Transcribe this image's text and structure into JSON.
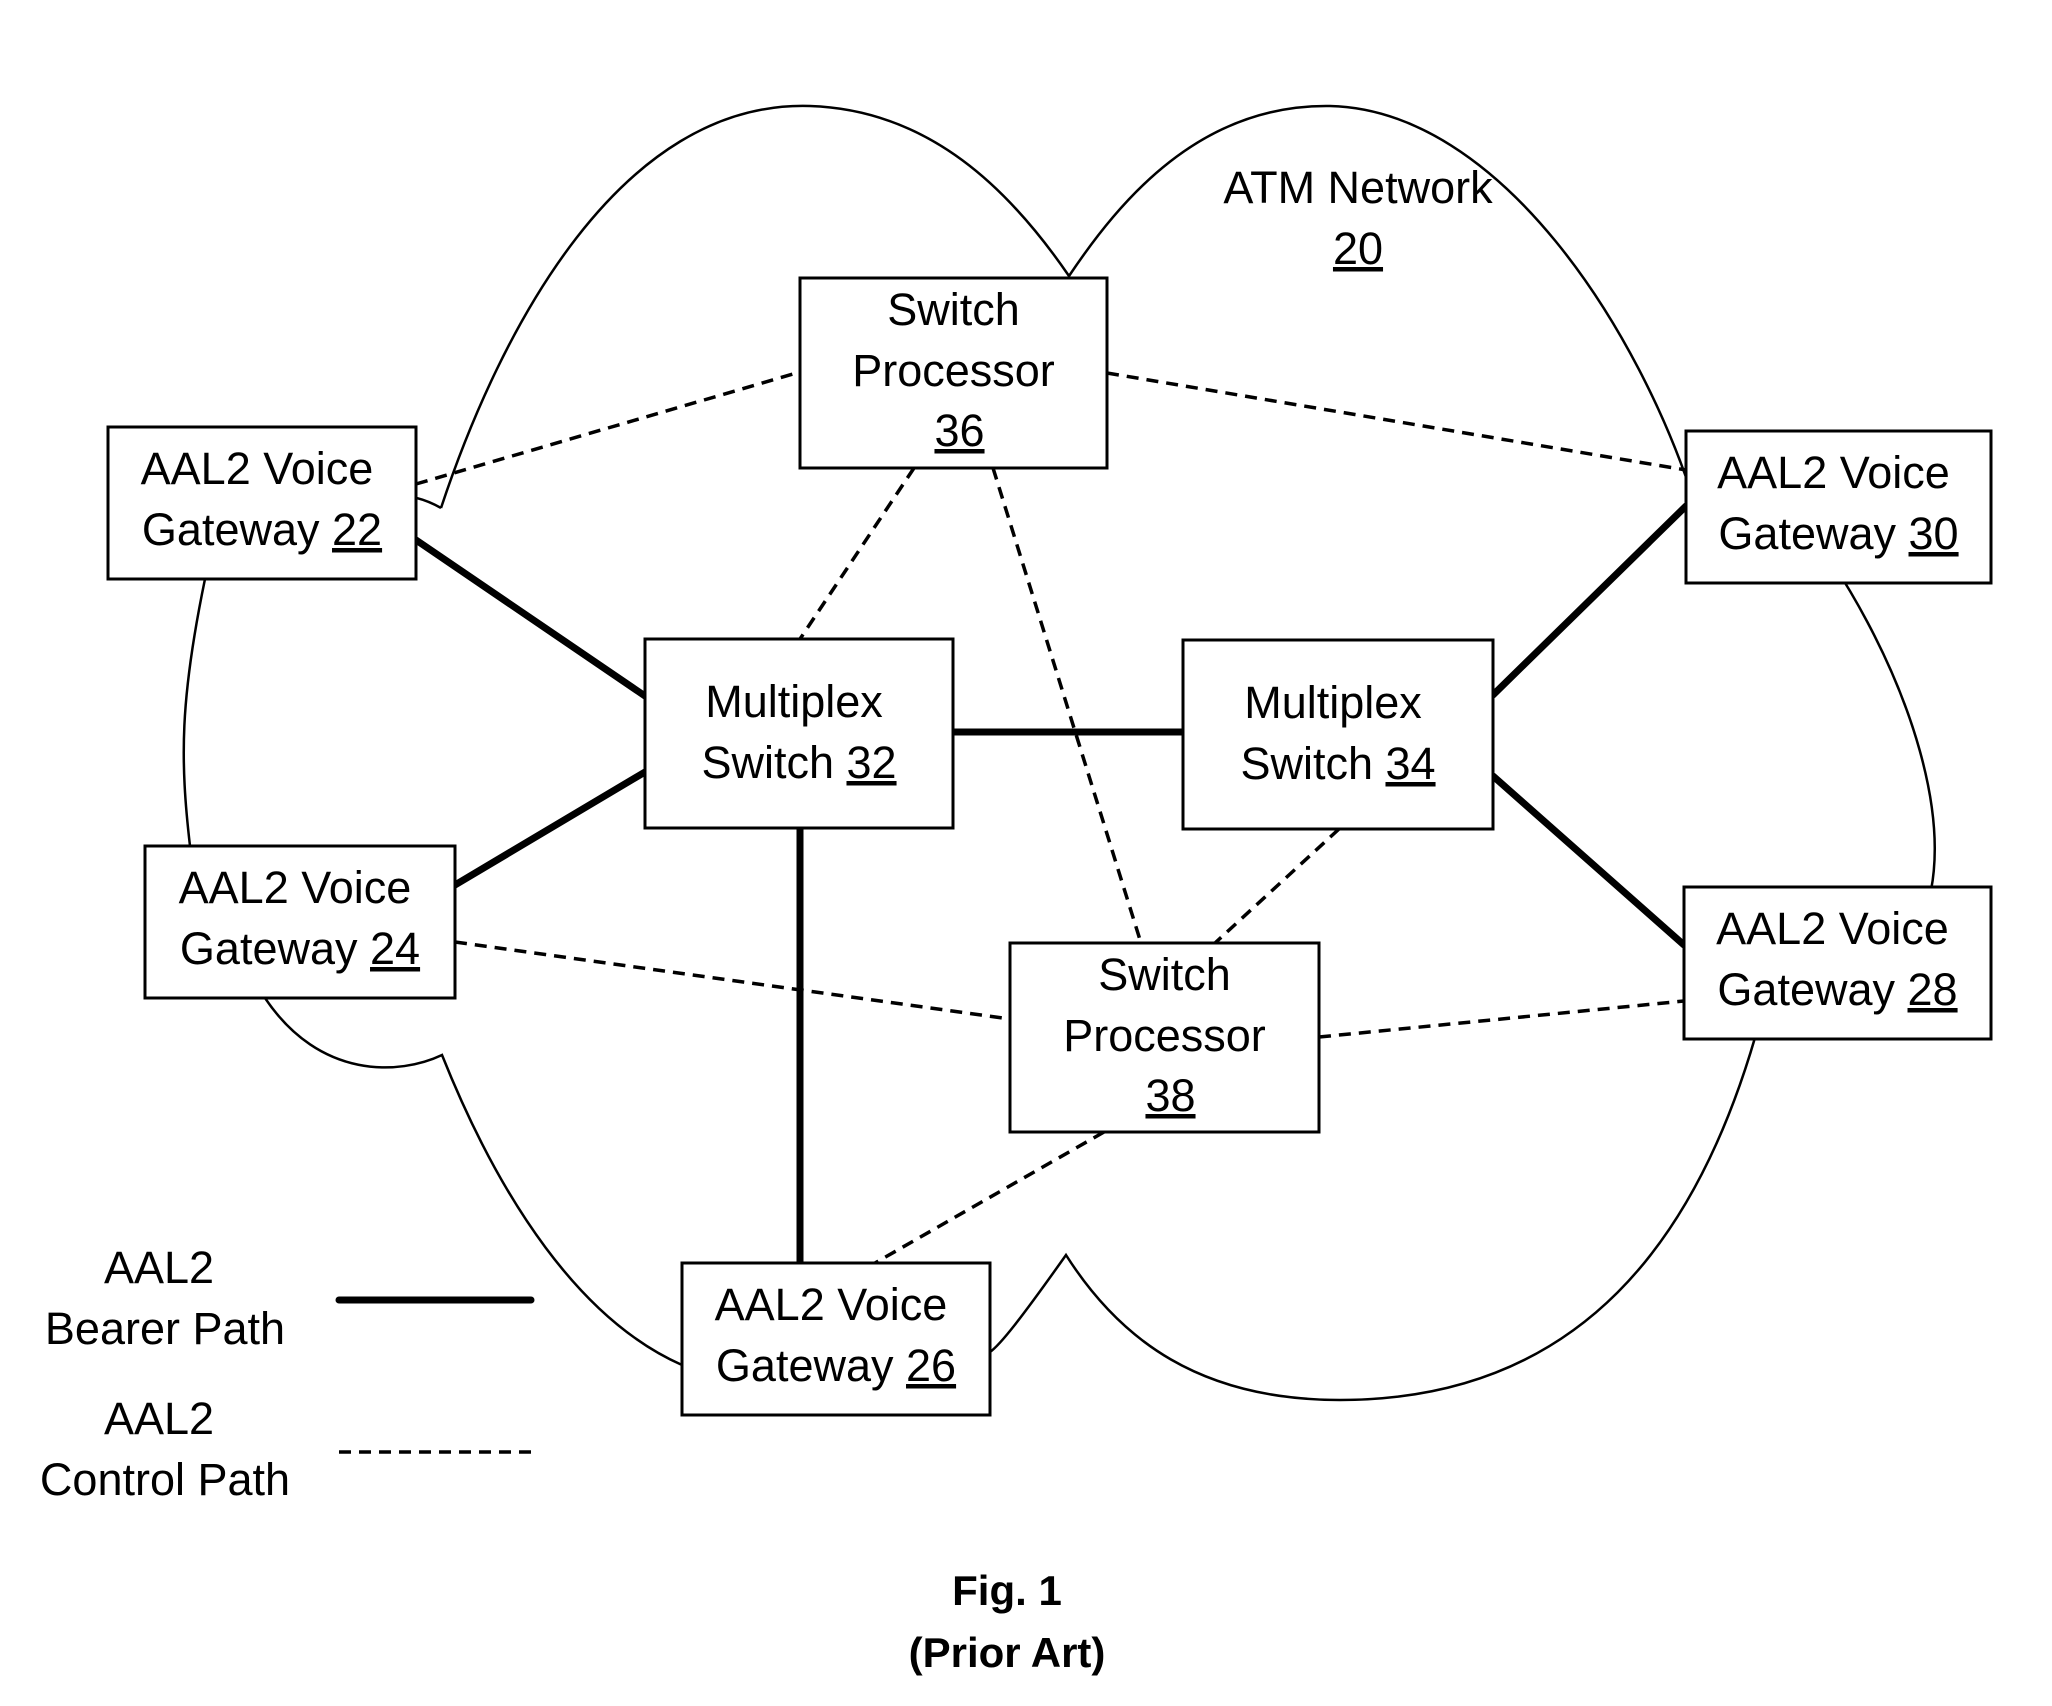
{
  "network": {
    "label": "ATM Network",
    "ref": "20"
  },
  "nodes": [
    {
      "id": "gw22",
      "type": "voice-gateway",
      "lines": [
        "AAL2 Voice",
        "Gateway "
      ],
      "ref": "22"
    },
    {
      "id": "sp36",
      "type": "switch-processor",
      "lines": [
        "Switch",
        "Processor"
      ],
      "ref": "36"
    },
    {
      "id": "gw30",
      "type": "voice-gateway",
      "lines": [
        "AAL2 Voice",
        "Gateway "
      ],
      "ref": "30"
    },
    {
      "id": "mx32",
      "type": "multiplex-switch",
      "lines": [
        "Multiplex",
        "Switch "
      ],
      "ref": "32"
    },
    {
      "id": "mx34",
      "type": "multiplex-switch",
      "lines": [
        "Multiplex",
        "Switch "
      ],
      "ref": "34"
    },
    {
      "id": "gw24",
      "type": "voice-gateway",
      "lines": [
        "AAL2 Voice",
        "Gateway "
      ],
      "ref": "24"
    },
    {
      "id": "sp38",
      "type": "switch-processor",
      "lines": [
        "Switch",
        "Processor"
      ],
      "ref": "38"
    },
    {
      "id": "gw28",
      "type": "voice-gateway",
      "lines": [
        "AAL2 Voice",
        "Gateway "
      ],
      "ref": "28"
    },
    {
      "id": "gw26",
      "type": "voice-gateway",
      "lines": [
        "AAL2 Voice",
        "Gateway "
      ],
      "ref": "26"
    }
  ],
  "edges": [
    {
      "from": "gw22",
      "to": "mx32",
      "kind": "bearer"
    },
    {
      "from": "gw24",
      "to": "mx32",
      "kind": "bearer"
    },
    {
      "from": "mx32",
      "to": "mx34",
      "kind": "bearer"
    },
    {
      "from": "mx32",
      "to": "gw26",
      "kind": "bearer"
    },
    {
      "from": "mx34",
      "to": "gw30",
      "kind": "bearer"
    },
    {
      "from": "mx34",
      "to": "gw28",
      "kind": "bearer"
    },
    {
      "from": "gw22",
      "to": "sp36",
      "kind": "control"
    },
    {
      "from": "sp36",
      "to": "gw30",
      "kind": "control"
    },
    {
      "from": "sp36",
      "to": "mx32",
      "kind": "control"
    },
    {
      "from": "sp36",
      "to": "sp38",
      "kind": "control"
    },
    {
      "from": "mx34",
      "to": "sp38",
      "kind": "control"
    },
    {
      "from": "gw24",
      "to": "sp38",
      "kind": "control"
    },
    {
      "from": "sp38",
      "to": "gw28",
      "kind": "control"
    },
    {
      "from": "sp38",
      "to": "gw26",
      "kind": "control"
    }
  ],
  "legend": {
    "bearer": {
      "line1": "AAL2",
      "line2": "Bearer Path"
    },
    "control": {
      "line1": "AAL2",
      "line2": "Control Path"
    }
  },
  "caption": {
    "title": "Fig. 1",
    "subtitle": "(Prior Art)"
  }
}
